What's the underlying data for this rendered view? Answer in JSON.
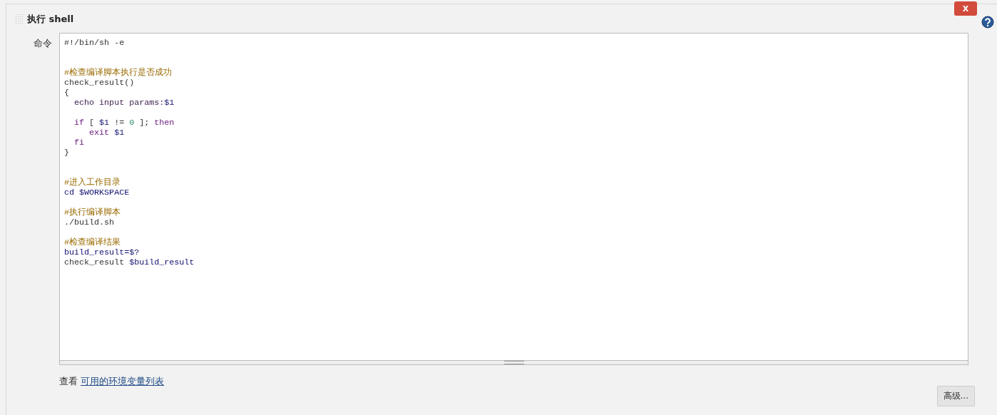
{
  "section": {
    "title": "执行 shell",
    "delete_label": "X",
    "field_label": "命令",
    "command_lines": [
      {
        "kind": "code",
        "tokens": [
          {
            "text": "#!/bin/sh -e",
            "kind": "plain"
          }
        ]
      },
      {
        "kind": "blank"
      },
      {
        "kind": "blank"
      },
      {
        "kind": "code",
        "tokens": [
          {
            "text": "#检查编译脚本执行是否成功",
            "kind": "comment"
          }
        ]
      },
      {
        "kind": "code",
        "tokens": [
          {
            "text": "check_result()",
            "kind": "plain"
          }
        ]
      },
      {
        "kind": "code",
        "tokens": [
          {
            "text": "{",
            "kind": "plain"
          }
        ]
      },
      {
        "kind": "code",
        "tokens": [
          {
            "text": "  echo input params:",
            "kind": "builtin"
          },
          {
            "text": "$1",
            "kind": "variable"
          }
        ]
      },
      {
        "kind": "blank"
      },
      {
        "kind": "code",
        "tokens": [
          {
            "text": "  if",
            "kind": "keyword"
          },
          {
            "text": " [ ",
            "kind": "plain"
          },
          {
            "text": "$1",
            "kind": "variable"
          },
          {
            "text": " != ",
            "kind": "plain"
          },
          {
            "text": "0",
            "kind": "number"
          },
          {
            "text": " ]; ",
            "kind": "plain"
          },
          {
            "text": "then",
            "kind": "keyword"
          }
        ]
      },
      {
        "kind": "code",
        "tokens": [
          {
            "text": "     exit",
            "kind": "keyword"
          },
          {
            "text": " $1",
            "kind": "variable"
          }
        ]
      },
      {
        "kind": "code",
        "tokens": [
          {
            "text": "  fi",
            "kind": "keyword"
          }
        ]
      },
      {
        "kind": "code",
        "tokens": [
          {
            "text": "}",
            "kind": "plain"
          }
        ]
      },
      {
        "kind": "blank"
      },
      {
        "kind": "blank"
      },
      {
        "kind": "code",
        "tokens": [
          {
            "text": "#进入工作目录",
            "kind": "comment"
          }
        ]
      },
      {
        "kind": "code",
        "tokens": [
          {
            "text": "cd $WORKSPACE",
            "kind": "variable"
          }
        ]
      },
      {
        "kind": "blank"
      },
      {
        "kind": "code",
        "tokens": [
          {
            "text": "#执行编译脚本",
            "kind": "comment"
          }
        ]
      },
      {
        "kind": "code",
        "tokens": [
          {
            "text": "./build.sh",
            "kind": "plain"
          }
        ]
      },
      {
        "kind": "blank"
      },
      {
        "kind": "code",
        "tokens": [
          {
            "text": "#检查编译结果",
            "kind": "comment"
          }
        ]
      },
      {
        "kind": "code",
        "tokens": [
          {
            "text": "build_result=$?",
            "kind": "variable"
          }
        ]
      },
      {
        "kind": "code",
        "tokens": [
          {
            "text": "check_result ",
            "kind": "plain"
          },
          {
            "text": "$build_result",
            "kind": "variable"
          }
        ]
      }
    ],
    "help_prefix": "查看",
    "help_link": "可用的环境变量列表",
    "advanced_button": "高级..."
  }
}
